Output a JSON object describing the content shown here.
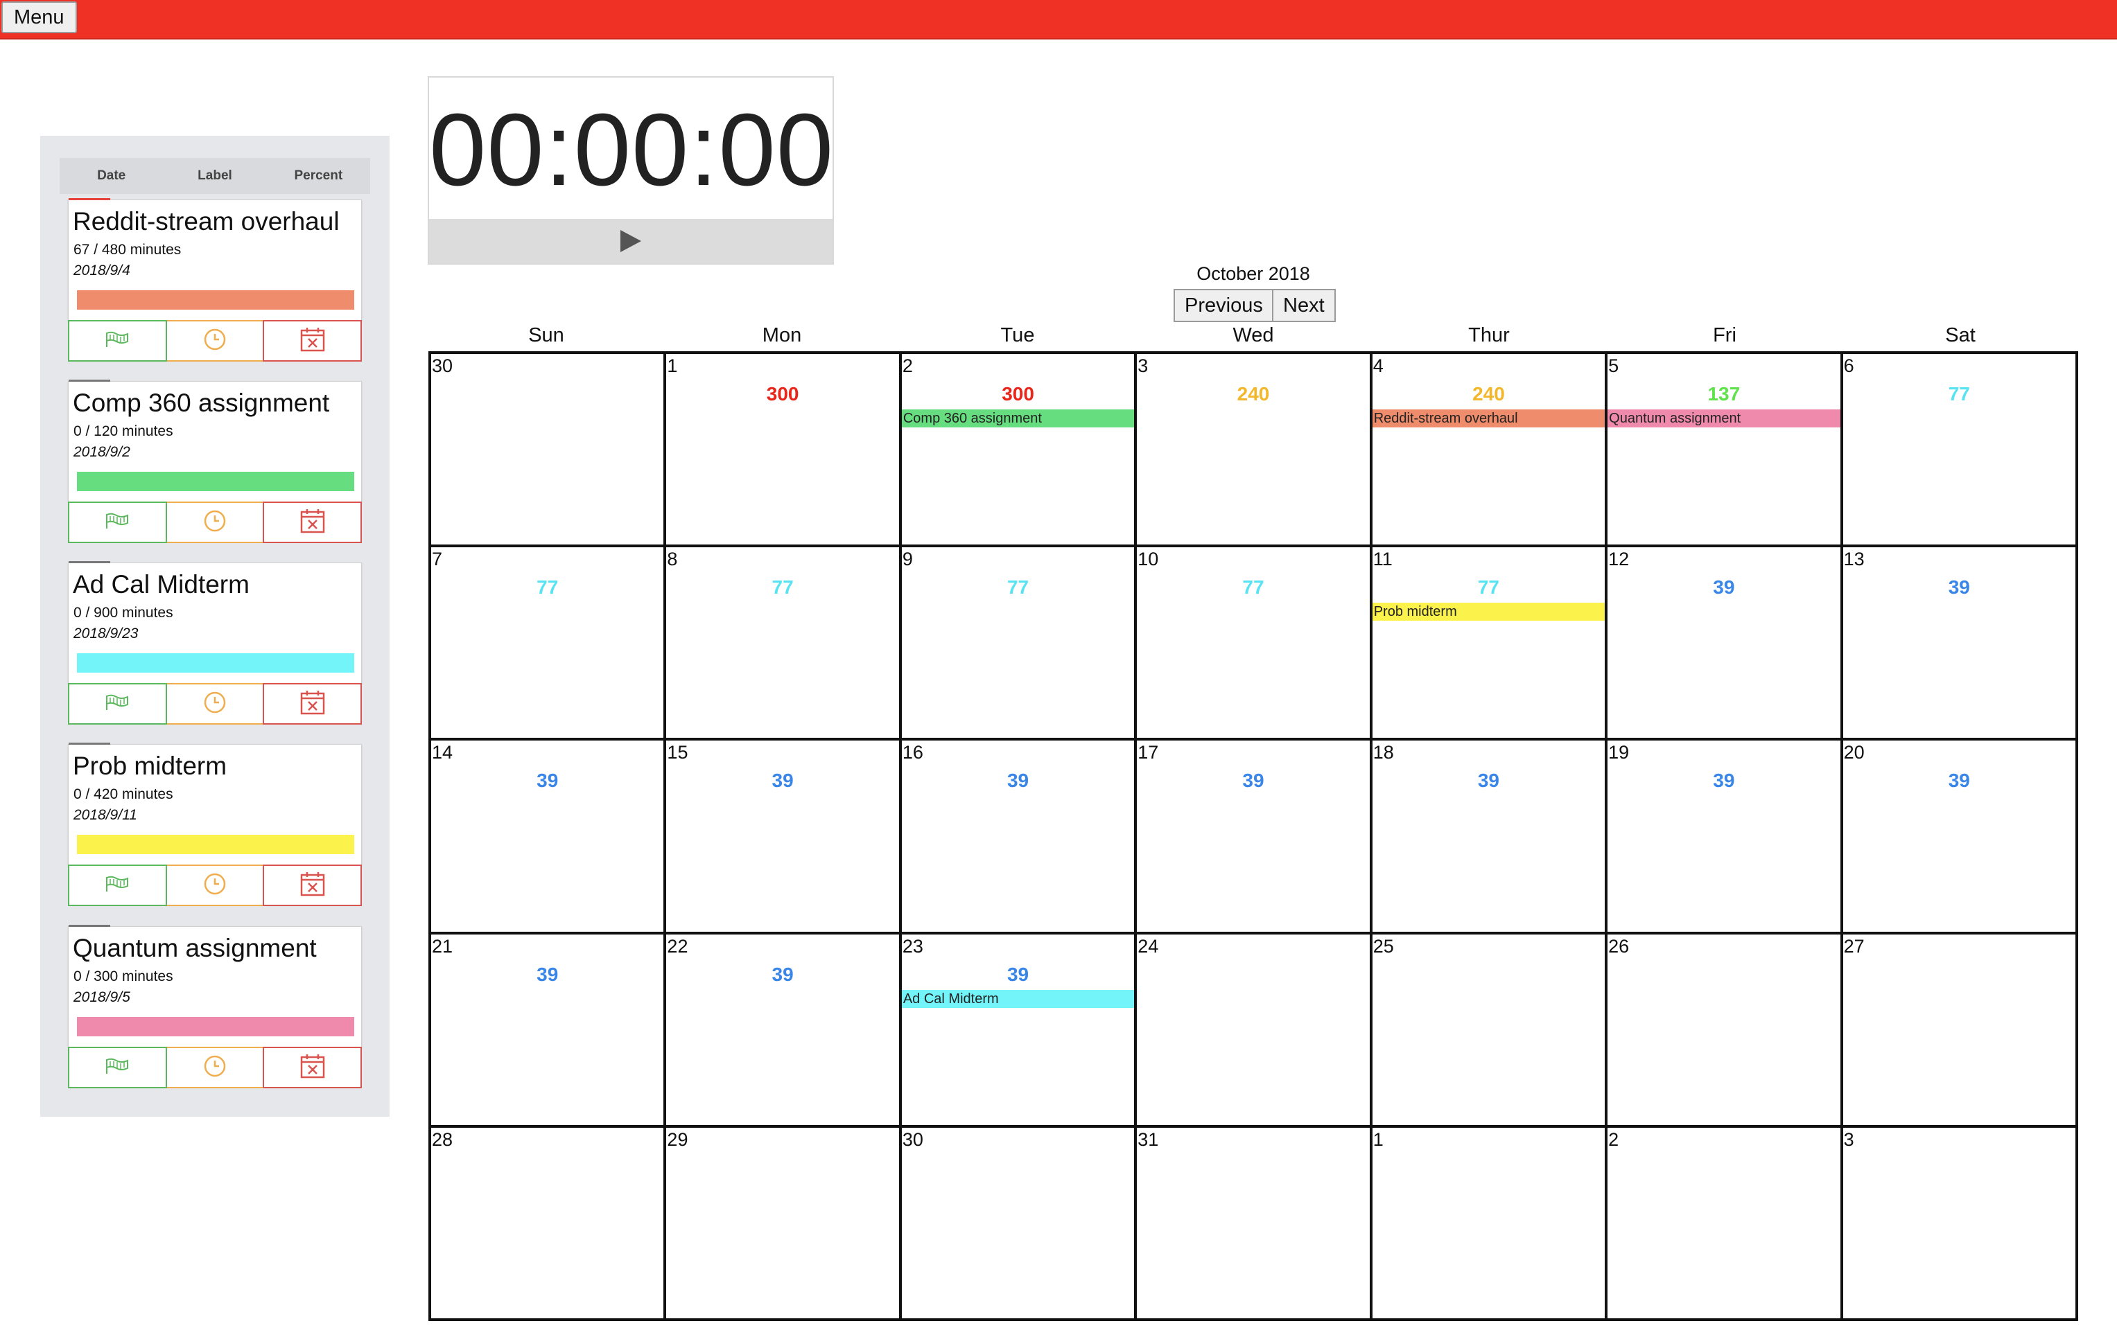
{
  "menu": {
    "label": "Menu"
  },
  "sidebar": {
    "sort": [
      "Date",
      "Label",
      "Percent"
    ],
    "tasks": [
      {
        "title": "Reddit-stream overhaul",
        "minutes": "67 / 480 minutes",
        "date": "2018/9/4",
        "color": "#ef8c6b",
        "tab": "#e8403a"
      },
      {
        "title": "Comp 360 assignment",
        "minutes": "0 / 120 minutes",
        "date": "2018/9/2",
        "color": "#66dd7e",
        "tab": "#777777"
      },
      {
        "title": "Ad Cal Midterm",
        "minutes": "0 / 900 minutes",
        "date": "2018/9/23",
        "color": "#72f4f9",
        "tab": "#777777"
      },
      {
        "title": "Prob midterm",
        "minutes": "0 / 420 minutes",
        "date": "2018/9/11",
        "color": "#fbf34b",
        "tab": "#777777"
      },
      {
        "title": "Quantum assignment",
        "minutes": "0 / 300 minutes",
        "date": "2018/9/5",
        "color": "#f08aac",
        "tab": "#777777"
      }
    ]
  },
  "timer": {
    "display": "00:00:00"
  },
  "calendar": {
    "month": "October 2018",
    "prev": "Previous",
    "next": "Next",
    "weekdays": [
      "Sun",
      "Mon",
      "Tue",
      "Wed",
      "Thur",
      "Fri",
      "Sat"
    ],
    "cells": [
      {
        "day": "30"
      },
      {
        "day": "1",
        "minutes": "300",
        "mcolor": "#e8261a"
      },
      {
        "day": "2",
        "minutes": "300",
        "mcolor": "#e8261a",
        "event": "Comp 360 assignment",
        "ecolor": "#66dd7e"
      },
      {
        "day": "3",
        "minutes": "240",
        "mcolor": "#f3b72c"
      },
      {
        "day": "4",
        "minutes": "240",
        "mcolor": "#f3b72c",
        "event": "Reddit-stream overhaul",
        "ecolor": "#ef8c6b"
      },
      {
        "day": "5",
        "minutes": "137",
        "mcolor": "#5fe24a",
        "event": "Quantum assignment",
        "ecolor": "#f08aac"
      },
      {
        "day": "6",
        "minutes": "77",
        "mcolor": "#58e3f2"
      },
      {
        "day": "7",
        "minutes": "77",
        "mcolor": "#58e3f2"
      },
      {
        "day": "8",
        "minutes": "77",
        "mcolor": "#58e3f2"
      },
      {
        "day": "9",
        "minutes": "77",
        "mcolor": "#58e3f2"
      },
      {
        "day": "10",
        "minutes": "77",
        "mcolor": "#58e3f2"
      },
      {
        "day": "11",
        "minutes": "77",
        "mcolor": "#58e3f2",
        "event": "Prob midterm",
        "ecolor": "#fbf34b"
      },
      {
        "day": "12",
        "minutes": "39",
        "mcolor": "#3a86e8"
      },
      {
        "day": "13",
        "minutes": "39",
        "mcolor": "#3a86e8"
      },
      {
        "day": "14",
        "minutes": "39",
        "mcolor": "#3a86e8"
      },
      {
        "day": "15",
        "minutes": "39",
        "mcolor": "#3a86e8"
      },
      {
        "day": "16",
        "minutes": "39",
        "mcolor": "#3a86e8"
      },
      {
        "day": "17",
        "minutes": "39",
        "mcolor": "#3a86e8"
      },
      {
        "day": "18",
        "minutes": "39",
        "mcolor": "#3a86e8"
      },
      {
        "day": "19",
        "minutes": "39",
        "mcolor": "#3a86e8"
      },
      {
        "day": "20",
        "minutes": "39",
        "mcolor": "#3a86e8"
      },
      {
        "day": "21",
        "minutes": "39",
        "mcolor": "#3a86e8"
      },
      {
        "day": "22",
        "minutes": "39",
        "mcolor": "#3a86e8"
      },
      {
        "day": "23",
        "minutes": "39",
        "mcolor": "#3a86e8",
        "event": "Ad Cal Midterm",
        "ecolor": "#72f4f9"
      },
      {
        "day": "24"
      },
      {
        "day": "25"
      },
      {
        "day": "26"
      },
      {
        "day": "27"
      },
      {
        "day": "28"
      },
      {
        "day": "29"
      },
      {
        "day": "30"
      },
      {
        "day": "31"
      },
      {
        "day": "1"
      },
      {
        "day": "2"
      },
      {
        "day": "3"
      }
    ]
  }
}
